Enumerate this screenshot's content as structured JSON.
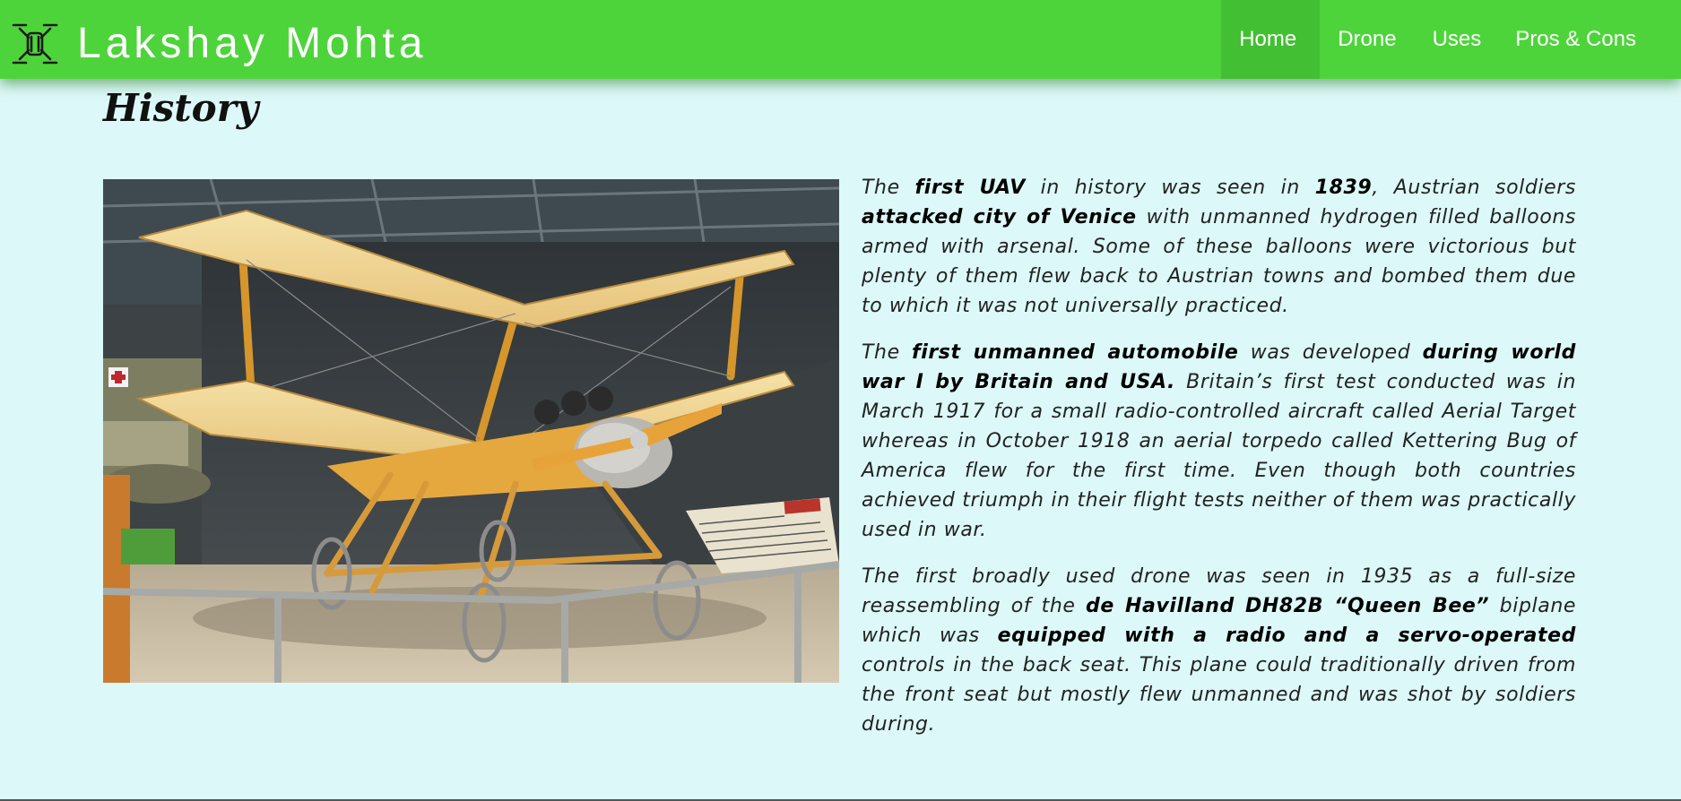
{
  "header": {
    "brand_name": "Lakshay Mohta",
    "logo_icon": "drone-icon",
    "accent_color": "#4ed43b",
    "nav": [
      {
        "label": "Home",
        "active": true
      },
      {
        "label": "Drone",
        "active": false
      },
      {
        "label": "Uses",
        "active": false
      },
      {
        "label": "Pros & Cons",
        "active": false
      }
    ]
  },
  "main": {
    "heading": "History",
    "image_subject": "kettering-bug-biplane-museum-photo",
    "image_sign": {
      "badge": "WWI",
      "title": "\"Bug\""
    },
    "paragraphs": [
      [
        {
          "t": "The ",
          "b": false
        },
        {
          "t": "first UAV",
          "b": true
        },
        {
          "t": " in history was seen in ",
          "b": false
        },
        {
          "t": "1839",
          "b": true
        },
        {
          "t": ", Austrian soldiers ",
          "b": false
        },
        {
          "t": "attacked city of Venice",
          "b": true
        },
        {
          "t": " with unmanned hydrogen filled balloons armed with arsenal. Some of these balloons were victorious but plenty of them flew back to Austrian towns and bombed them due to which it was not universally practiced.",
          "b": false
        }
      ],
      [
        {
          "t": "The ",
          "b": false
        },
        {
          "t": "first unmanned automobile",
          "b": true
        },
        {
          "t": " was developed ",
          "b": false
        },
        {
          "t": "during world war I by Britain and USA.",
          "b": true
        },
        {
          "t": " Britain’s first test conducted was in March 1917 for a small radio-controlled aircraft called Aerial Target whereas in October 1918 an aerial torpedo called Kettering Bug of America flew for the first time. Even though both countries achieved triumph in their flight tests neither of them was practically used in war.",
          "b": false
        }
      ],
      [
        {
          "t": "The first broadly used drone was seen in 1935 as a full-size reassembling of the ",
          "b": false
        },
        {
          "t": "de Havilland DH82B “Queen Bee”",
          "b": true
        },
        {
          "t": " biplane which was ",
          "b": false
        },
        {
          "t": "equipped with a radio and a servo-operated",
          "b": true
        },
        {
          "t": " controls in the back seat. This plane could traditionally driven from the front seat but mostly flew unmanned and was shot by soldiers during.",
          "b": false
        }
      ]
    ]
  }
}
